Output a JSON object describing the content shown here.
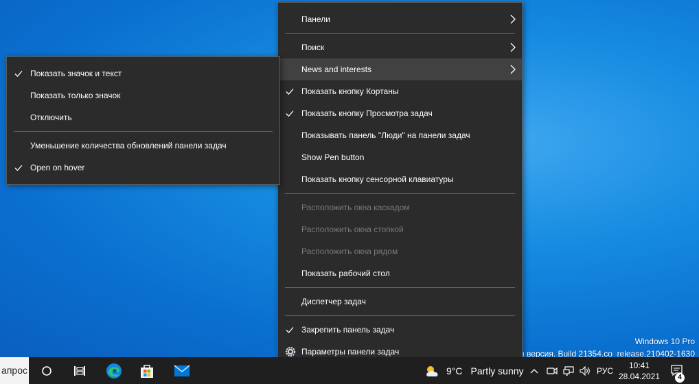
{
  "watermark": {
    "edition": "Windows 10 Pro",
    "build": "ная версия. Build 21354.co_release.210402-1630"
  },
  "main_menu": {
    "items": [
      {
        "label": "Панели",
        "checked": false,
        "disabled": false,
        "submenu": true
      },
      {
        "label": "Поиск",
        "checked": false,
        "disabled": false,
        "submenu": true
      },
      {
        "label": "News and interests",
        "checked": false,
        "disabled": false,
        "submenu": true,
        "highlighted": true
      },
      {
        "label": "Показать кнопку Кортаны",
        "checked": true,
        "disabled": false
      },
      {
        "label": "Показать кнопку Просмотра задач",
        "checked": true,
        "disabled": false
      },
      {
        "label": "Показывать панель \"Люди\" на панели задач",
        "checked": false,
        "disabled": false
      },
      {
        "label": "Show Pen button",
        "checked": false,
        "disabled": false
      },
      {
        "label": "Показать кнопку сенсорной клавиатуры",
        "checked": false,
        "disabled": false
      },
      {
        "label": "Расположить окна каскадом",
        "checked": false,
        "disabled": true
      },
      {
        "label": "Расположить окна стопкой",
        "checked": false,
        "disabled": true
      },
      {
        "label": "Расположить окна рядом",
        "checked": false,
        "disabled": true
      },
      {
        "label": "Показать рабочий стол",
        "checked": false,
        "disabled": false
      },
      {
        "label": "Диспетчер задач",
        "checked": false,
        "disabled": false
      },
      {
        "label": "Закрепить панель задач",
        "checked": true,
        "disabled": false
      },
      {
        "label": "Параметры панели задач",
        "checked": false,
        "disabled": false,
        "icon": "gear-icon"
      }
    ]
  },
  "sub_menu": {
    "items": [
      {
        "label": "Показать значок и текст",
        "checked": true
      },
      {
        "label": "Показать только значок",
        "checked": false
      },
      {
        "label": "Отключить",
        "checked": false
      },
      {
        "label": "Уменьшение количества обновлений панели задач",
        "checked": false
      },
      {
        "label": "Open on hover",
        "checked": true
      }
    ]
  },
  "taskbar": {
    "search_text": "апрос",
    "pinned_icons": [
      "cortana-icon",
      "task-view-icon",
      "edge-icon",
      "store-icon",
      "mail-icon"
    ],
    "weather": {
      "temperature": "9°C",
      "condition": "Partly sunny",
      "icon": "partly-sunny-icon"
    },
    "tray_icons": [
      "chevron-up-icon",
      "meet-now-icon",
      "network-icon",
      "volume-icon"
    ],
    "language": "РУС",
    "time": "10:41",
    "date": "28.04.2021",
    "notification_count": "4"
  },
  "colors": {
    "menu_bg": "#2b2b2b",
    "menu_highlight": "#414141",
    "taskbar_bg": "#1f1f1f",
    "desktop_blue": "#168be0",
    "edge_blue": "#0f8ae0",
    "store_bg": "#f3f3f3",
    "mail_blue": "#0078d7"
  }
}
